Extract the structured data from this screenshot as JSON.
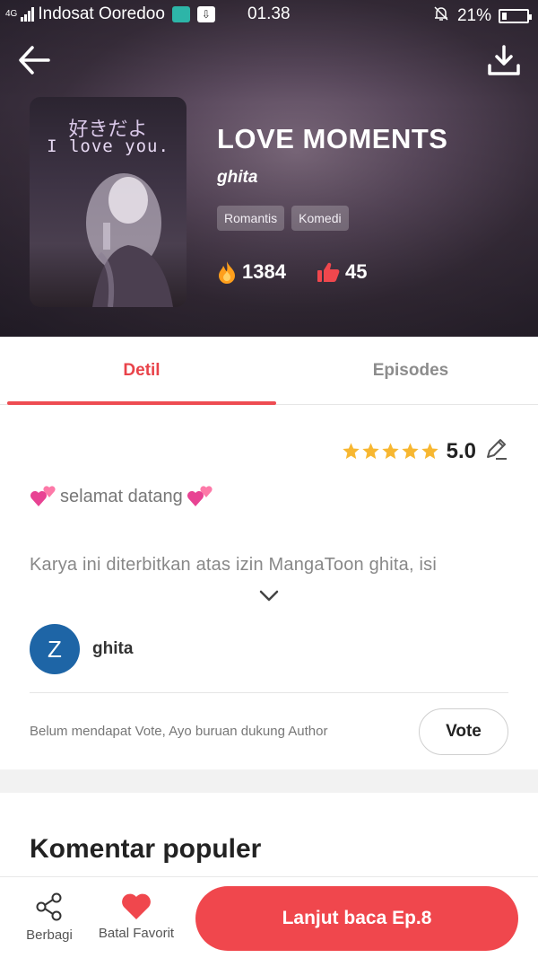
{
  "status_bar": {
    "network": "4G",
    "carrier": "Indosat Ooredoo",
    "time": "01.38",
    "battery": "21%",
    "battery_level": 0.21
  },
  "header": {
    "back_icon": "back-arrow-icon",
    "download_icon": "download-icon"
  },
  "cover": {
    "jp_text": "好きだよ",
    "en_text": "I love you."
  },
  "book": {
    "title": "LOVE MOMENTS",
    "author": "ghita",
    "tags": [
      "Romantis",
      "Komedi"
    ],
    "fire_count": "1384",
    "like_count": "45"
  },
  "tabs": [
    {
      "label": "Detil",
      "active": true
    },
    {
      "label": "Episodes",
      "active": false
    }
  ],
  "rating": {
    "stars": 5,
    "value": "5.0"
  },
  "description": {
    "welcome": "selamat datang",
    "text": "Karya ini diterbitkan atas izin MangaToon ghita, isi"
  },
  "author_section": {
    "avatar_letter": "Z",
    "name": "ghita",
    "vote_prompt": "Belum mendapat Vote, Ayo buruan dukung Author",
    "vote_button": "Vote"
  },
  "comments": {
    "heading": "Komentar populer"
  },
  "bottom_bar": {
    "share_label": "Berbagi",
    "favorite_label": "Batal Favorit",
    "cta_label": "Lanjut baca Ep.8"
  },
  "colors": {
    "accent": "#f0474d",
    "tab_active": "#e9434a",
    "avatar_bg": "#1e65a6",
    "star": "#f7b731"
  }
}
